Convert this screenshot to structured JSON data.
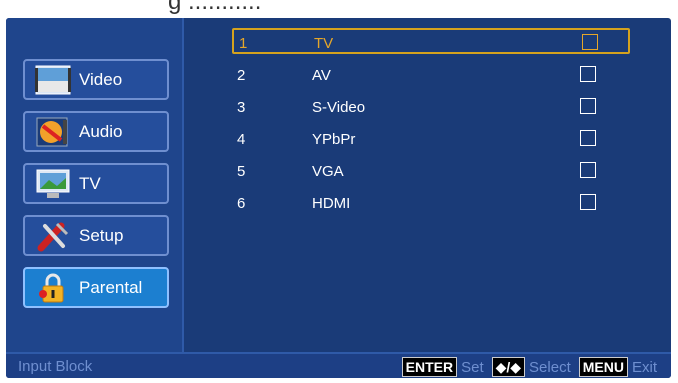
{
  "banner": {
    "text": "g      ..........."
  },
  "sidebar": {
    "items": [
      {
        "label": "Video",
        "icon": "video-icon"
      },
      {
        "label": "Audio",
        "icon": "audio-icon"
      },
      {
        "label": "TV",
        "icon": "tv-icon"
      },
      {
        "label": "Setup",
        "icon": "setup-icon"
      },
      {
        "label": "Parental",
        "icon": "lock-icon",
        "active": true
      }
    ]
  },
  "inputs": [
    {
      "num": "1",
      "label": "TV",
      "checked": false,
      "selected": true
    },
    {
      "num": "2",
      "label": "AV",
      "checked": false
    },
    {
      "num": "3",
      "label": "S-Video",
      "checked": false
    },
    {
      "num": "4",
      "label": "YPbPr",
      "checked": false
    },
    {
      "num": "5",
      "label": "VGA",
      "checked": false
    },
    {
      "num": "6",
      "label": "HDMI",
      "checked": false
    }
  ],
  "footer": {
    "title": "Input Block",
    "enter_key": "ENTER",
    "enter_hint": "Set",
    "select_key": "◆/◆",
    "select_hint": "Select",
    "menu_key": "MENU",
    "menu_hint": "Exit"
  },
  "colors": {
    "frame": "#1a3b78",
    "selected_border": "#d4a21f",
    "active_tab": "#1c7fd0"
  }
}
